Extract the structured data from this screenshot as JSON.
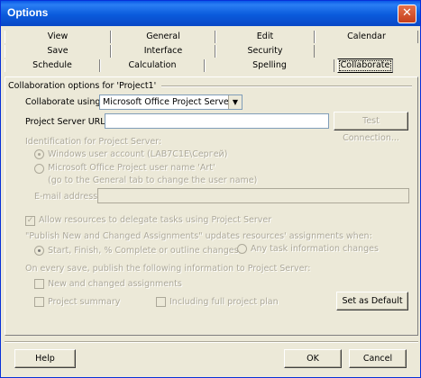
{
  "window": {
    "title": "Options",
    "close_glyph": "✕"
  },
  "tabs": {
    "row_front": [
      {
        "label": "View"
      },
      {
        "label": "General"
      },
      {
        "label": "Edit"
      },
      {
        "label": "Calendar"
      }
    ],
    "row_middle": [
      {
        "label": "Save"
      },
      {
        "label": "Interface"
      },
      {
        "label": "Security"
      }
    ],
    "row_back": [
      {
        "label": "Schedule"
      },
      {
        "label": "Calculation"
      },
      {
        "label": "Spelling"
      },
      {
        "label": "Collaborate"
      }
    ],
    "active": "Collaborate"
  },
  "collab": {
    "section_title": "Collaboration options for 'Project1'",
    "collaborate_using_label": "Collaborate using:",
    "collaborate_using_value": "Microsoft Office Project Server",
    "project_server_url_label": "Project Server URL:",
    "project_server_url_value": "",
    "test_connection": "Test Connection...",
    "identification_label": "Identification for Project Server:",
    "windows_account": "Windows user account (LAB7C1E\\Сергей)",
    "ms_project_user": "Microsoft Office Project user name 'Art'",
    "ms_project_user_hint": "(go to the General tab to change the user name)",
    "email_label": "E-mail address:",
    "email_value": "",
    "allow_delegate": "Allow resources to delegate tasks using Project Server",
    "publish_updates_label": "\"Publish New and Changed Assignments\" updates resources' assignments when:",
    "start_finish": "Start, Finish, % Complete or outline changes",
    "any_task": "Any task information changes",
    "on_every_save": "On every save, publish the following information to Project Server:",
    "new_changed": "New and changed assignments",
    "project_summary": "Project summary",
    "including_full": "Including full project plan",
    "set_default": "Set as Default"
  },
  "footer": {
    "help": "Help",
    "ok": "OK",
    "cancel": "Cancel"
  },
  "colors": {
    "titlebar": "#0a58e6",
    "face": "#ece9d8",
    "disabled_text": "#aca899"
  }
}
